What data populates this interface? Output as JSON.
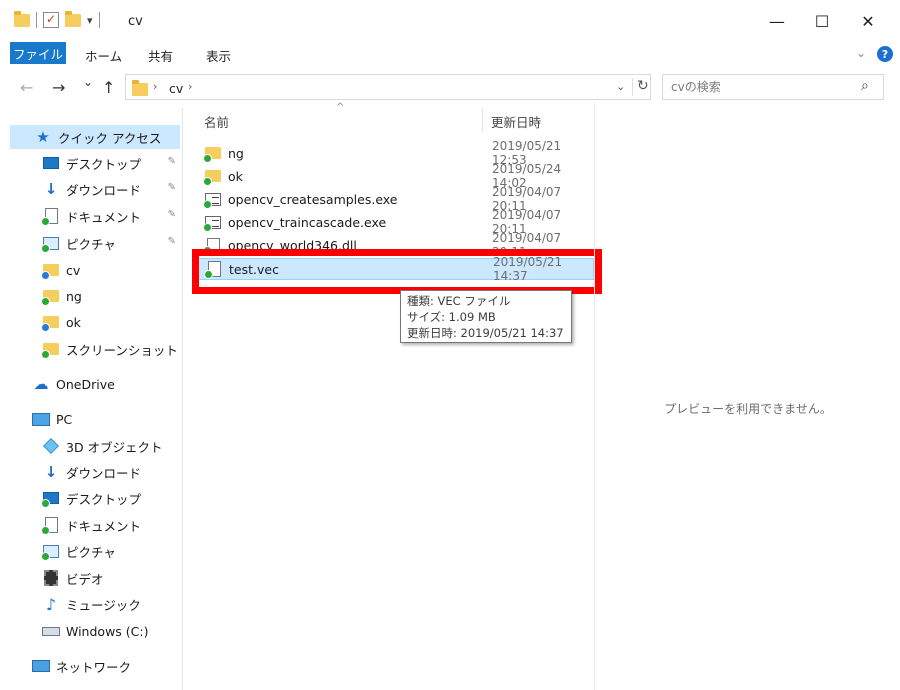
{
  "window": {
    "title": "cv",
    "minimize": "—",
    "maximize": "☐",
    "close": "✕"
  },
  "ribbon": {
    "file": "ファイル",
    "tabs": [
      "ホーム",
      "共有",
      "表示"
    ],
    "help": "?"
  },
  "nav": {
    "back": "←",
    "forward": "→",
    "recent": "⌄",
    "up": "↑"
  },
  "address": {
    "crumb": "cv",
    "sep": "›"
  },
  "search": {
    "placeholder": "cvの検索",
    "icon": "⌕"
  },
  "sidebar": {
    "items": [
      {
        "label": "クイック アクセス",
        "icon": "star-icon"
      },
      {
        "label": "デスクトップ",
        "icon": "desktop-icon",
        "pinned": true
      },
      {
        "label": "ダウンロード",
        "icon": "download-icon",
        "pinned": true
      },
      {
        "label": "ドキュメント",
        "icon": "documents-icon",
        "pinned": true
      },
      {
        "label": "ピクチャ",
        "icon": "pictures-icon",
        "pinned": true
      },
      {
        "label": "cv",
        "icon": "folder-icon"
      },
      {
        "label": "ng",
        "icon": "folder-icon"
      },
      {
        "label": "ok",
        "icon": "folder-icon"
      },
      {
        "label": "スクリーンショット",
        "icon": "folder-icon"
      },
      {
        "label": "OneDrive",
        "icon": "cloud-icon"
      },
      {
        "label": "PC",
        "icon": "pc-icon"
      },
      {
        "label": "3D オブジェクト",
        "icon": "3d-objects-icon"
      },
      {
        "label": "ダウンロード",
        "icon": "download-icon"
      },
      {
        "label": "デスクトップ",
        "icon": "desktop-icon"
      },
      {
        "label": "ドキュメント",
        "icon": "documents-icon"
      },
      {
        "label": "ピクチャ",
        "icon": "pictures-icon"
      },
      {
        "label": "ビデオ",
        "icon": "videos-icon"
      },
      {
        "label": "ミュージック",
        "icon": "music-icon"
      },
      {
        "label": "Windows (C:)",
        "icon": "drive-icon"
      },
      {
        "label": "ネットワーク",
        "icon": "network-icon"
      }
    ],
    "pin_glyph": "📌"
  },
  "filelist": {
    "columns": {
      "name": "名前",
      "date": "更新日時"
    },
    "sort_caret": "^",
    "rows": [
      {
        "name": "ng",
        "date": "2019/05/21 12:53",
        "icon": "folder-icon"
      },
      {
        "name": "ok",
        "date": "2019/05/24 14:02",
        "icon": "folder-icon"
      },
      {
        "name": "opencv_createsamples.exe",
        "date": "2019/04/07 20:11",
        "icon": "exe-icon"
      },
      {
        "name": "opencv_traincascade.exe",
        "date": "2019/04/07 20:11",
        "icon": "exe-icon"
      },
      {
        "name": "opencv_world346.dll",
        "date": "2019/04/07 20:11",
        "icon": "dll-icon"
      },
      {
        "name": "test.vec",
        "date": "2019/05/21 14:37",
        "icon": "file-icon",
        "selected": true
      }
    ]
  },
  "tooltip": {
    "line1": "種類: VEC ファイル",
    "line2": "サイズ: 1.09 MB",
    "line3": "更新日時: 2019/05/21 14:37"
  },
  "preview": {
    "message": "プレビューを利用できません。"
  },
  "colors": {
    "accent": "#1979ca",
    "selection": "#cce8ff",
    "highlight": "#ff0000"
  }
}
